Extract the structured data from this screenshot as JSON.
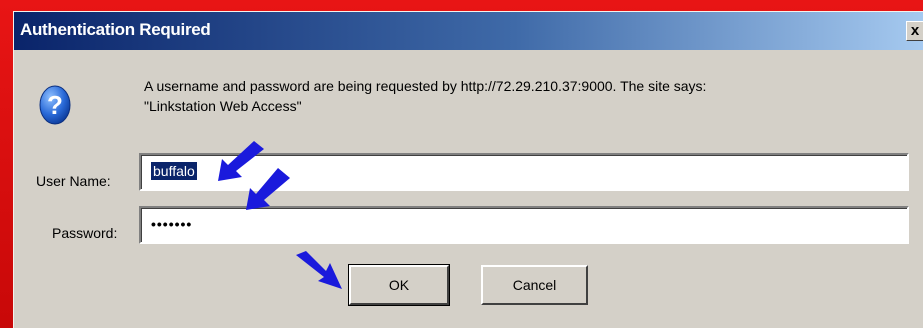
{
  "dialog": {
    "title": "Authentication Required",
    "close_glyph": "x",
    "message_line1": "A username and password are being requested by http://72.29.210.37:9000. The site says:",
    "message_line2": "\"Linkstation Web Access\"",
    "icon": "question-icon"
  },
  "form": {
    "username_label": "User Name:",
    "username_value": "buffalo",
    "password_label": "Password:",
    "password_value": "•••••••"
  },
  "buttons": {
    "ok_label": "OK",
    "cancel_label": "Cancel"
  },
  "annotations": {
    "arrow_color": "#1a1adc",
    "arrows": [
      "arrow-pointing-username",
      "arrow-pointing-password",
      "arrow-pointing-ok"
    ]
  },
  "colors": {
    "frame": "#d40d0d",
    "titlebar_start": "#0a246a",
    "titlebar_end": "#a6caf0",
    "dialog_bg": "#d4d0c8"
  }
}
